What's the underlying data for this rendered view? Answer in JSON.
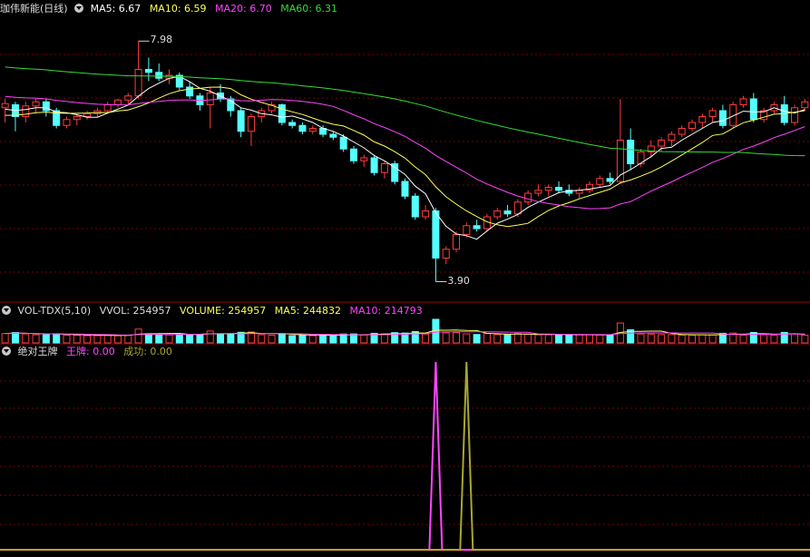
{
  "colors": {
    "up": "#ff3b3b",
    "down": "#54ffff",
    "ma5": "#ffffff",
    "ma10": "#ffff55",
    "ma20": "#ff44ff",
    "ma60": "#33dd33",
    "grid": "#7a0000",
    "wangpai": "#ff44ff",
    "chenggong": "#a8a830"
  },
  "main_panel": {
    "title": "珈伟新能(日线)",
    "ma5_label": "MA5: 6.67",
    "ma10_label": "MA10: 6.59",
    "ma20_label": "MA20: 6.70",
    "ma60_label": "MA60: 6.31",
    "high_label": "7.98",
    "low_label": "3.90"
  },
  "vol_panel": {
    "title": "VOL-TDX(5,10)",
    "vvol_label": "VVOL: 254957",
    "volume_label": "VOLUME: 254957",
    "ma5_label": "MA5: 244832",
    "ma10_label": "MA10: 214793"
  },
  "ind_panel": {
    "title": "绝对王牌",
    "wangpai_label": "王牌: 0.00",
    "chenggong_label": "成功: 0.00"
  },
  "chart_data": [
    {
      "type": "candlestick",
      "title": "珈伟新能(日线)",
      "ylim": [
        3.6,
        8.4
      ],
      "annotations": [
        {
          "text": "7.98",
          "value": 7.98
        },
        {
          "text": "3.90",
          "value": 3.9
        }
      ],
      "candles": [
        [
          6.85,
          7.0,
          6.6,
          6.92
        ],
        [
          6.9,
          6.95,
          6.45,
          6.7
        ],
        [
          6.7,
          6.95,
          6.6,
          6.88
        ],
        [
          6.88,
          7.0,
          6.75,
          6.95
        ],
        [
          6.95,
          7.0,
          6.7,
          6.8
        ],
        [
          6.8,
          6.85,
          6.5,
          6.55
        ],
        [
          6.55,
          6.7,
          6.5,
          6.65
        ],
        [
          6.65,
          6.75,
          6.55,
          6.7
        ],
        [
          6.7,
          6.8,
          6.65,
          6.75
        ],
        [
          6.75,
          6.85,
          6.7,
          6.8
        ],
        [
          6.8,
          6.95,
          6.75,
          6.9
        ],
        [
          6.9,
          7.0,
          6.85,
          6.98
        ],
        [
          6.98,
          7.1,
          6.9,
          7.05
        ],
        [
          7.05,
          7.98,
          7.0,
          7.5
        ],
        [
          7.5,
          7.7,
          7.3,
          7.45
        ],
        [
          7.45,
          7.6,
          7.3,
          7.35
        ],
        [
          7.35,
          7.5,
          7.25,
          7.4
        ],
        [
          7.4,
          7.45,
          7.15,
          7.2
        ],
        [
          7.2,
          7.3,
          7.0,
          7.05
        ],
        [
          7.05,
          7.1,
          6.8,
          6.9
        ],
        [
          6.9,
          7.2,
          6.5,
          7.1
        ],
        [
          7.1,
          7.25,
          6.95,
          7.0
        ],
        [
          7.0,
          7.05,
          6.7,
          6.8
        ],
        [
          6.8,
          6.85,
          6.35,
          6.45
        ],
        [
          6.45,
          6.75,
          6.2,
          6.7
        ],
        [
          6.7,
          6.85,
          6.6,
          6.8
        ],
        [
          6.8,
          6.95,
          6.75,
          6.9
        ],
        [
          6.9,
          6.92,
          6.55,
          6.6
        ],
        [
          6.6,
          6.65,
          6.5,
          6.55
        ],
        [
          6.55,
          6.6,
          6.4,
          6.45
        ],
        [
          6.45,
          6.55,
          6.4,
          6.5
        ],
        [
          6.5,
          6.55,
          6.35,
          6.4
        ],
        [
          6.4,
          6.45,
          6.3,
          6.35
        ],
        [
          6.35,
          6.4,
          6.1,
          6.15
        ],
        [
          6.15,
          6.2,
          5.9,
          5.95
        ],
        [
          5.95,
          6.05,
          5.85,
          6.0
        ],
        [
          6.0,
          6.05,
          5.7,
          5.75
        ],
        [
          5.75,
          5.95,
          5.65,
          5.9
        ],
        [
          5.9,
          5.95,
          5.55,
          5.6
        ],
        [
          5.6,
          5.65,
          5.3,
          5.35
        ],
        [
          5.35,
          5.4,
          4.95,
          5.0
        ],
        [
          5.0,
          5.2,
          4.95,
          5.1
        ],
        [
          5.1,
          5.15,
          3.9,
          4.3
        ],
        [
          4.3,
          4.5,
          4.2,
          4.45
        ],
        [
          4.45,
          4.75,
          4.4,
          4.7
        ],
        [
          4.7,
          4.9,
          4.65,
          4.85
        ],
        [
          4.85,
          4.95,
          4.75,
          4.8
        ],
        [
          4.8,
          5.05,
          4.75,
          5.0
        ],
        [
          5.0,
          5.15,
          4.95,
          5.1
        ],
        [
          5.1,
          5.2,
          5.0,
          5.05
        ],
        [
          5.05,
          5.3,
          5.0,
          5.25
        ],
        [
          5.25,
          5.45,
          5.2,
          5.4
        ],
        [
          5.4,
          5.55,
          5.35,
          5.45
        ],
        [
          5.45,
          5.55,
          5.35,
          5.5
        ],
        [
          5.5,
          5.6,
          5.4,
          5.45
        ],
        [
          5.45,
          5.55,
          5.35,
          5.4
        ],
        [
          5.4,
          5.5,
          5.3,
          5.45
        ],
        [
          5.45,
          5.6,
          5.4,
          5.55
        ],
        [
          5.55,
          5.7,
          5.5,
          5.65
        ],
        [
          5.65,
          5.75,
          5.55,
          5.6
        ],
        [
          5.6,
          7.0,
          5.55,
          6.3
        ],
        [
          6.3,
          6.5,
          5.8,
          5.9
        ],
        [
          5.9,
          6.15,
          5.85,
          6.1
        ],
        [
          6.1,
          6.3,
          6.0,
          6.2
        ],
        [
          6.2,
          6.35,
          6.1,
          6.3
        ],
        [
          6.3,
          6.45,
          6.2,
          6.4
        ],
        [
          6.4,
          6.55,
          6.35,
          6.5
        ],
        [
          6.5,
          6.65,
          6.45,
          6.6
        ],
        [
          6.6,
          6.75,
          6.5,
          6.7
        ],
        [
          6.7,
          6.85,
          6.6,
          6.8
        ],
        [
          6.8,
          6.9,
          6.5,
          6.55
        ],
        [
          6.55,
          6.95,
          6.5,
          6.9
        ],
        [
          6.9,
          7.05,
          6.85,
          7.0
        ],
        [
          7.0,
          7.1,
          6.6,
          6.65
        ],
        [
          6.65,
          6.85,
          6.6,
          6.8
        ],
        [
          6.8,
          6.95,
          6.75,
          6.9
        ],
        [
          6.9,
          7.05,
          6.55,
          6.6
        ],
        [
          6.6,
          6.9,
          6.55,
          6.85
        ],
        [
          6.85,
          7.0,
          6.8,
          6.95
        ]
      ],
      "series": [
        {
          "name": "MA5",
          "last": 6.67
        },
        {
          "name": "MA10",
          "last": 6.59
        },
        {
          "name": "MA20",
          "last": 6.7
        },
        {
          "name": "MA60",
          "last": 6.31
        }
      ]
    },
    {
      "type": "bar",
      "title": "VOL-TDX(5,10)",
      "series": [
        {
          "name": "VOLUME",
          "last": 254957
        },
        {
          "name": "MA5",
          "last": 244832
        },
        {
          "name": "MA10",
          "last": 214793
        }
      ]
    },
    {
      "type": "line",
      "title": "绝对王牌",
      "series": [
        {
          "name": "王牌",
          "last": 0.0,
          "spike_bar": 42
        },
        {
          "name": "成功",
          "last": 0.0,
          "spike_bar": 45
        }
      ]
    }
  ]
}
